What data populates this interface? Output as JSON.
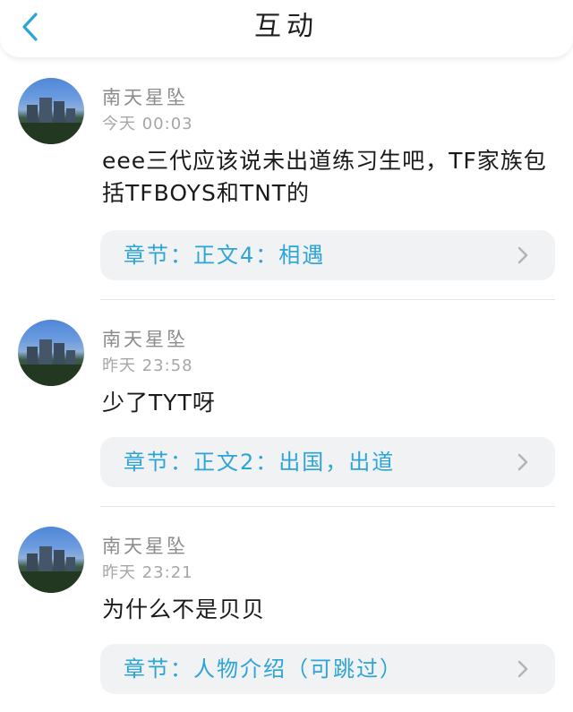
{
  "header": {
    "title": "互动",
    "back_icon": "chevron-left-icon",
    "accent": "#2ca4d6"
  },
  "comments": [
    {
      "username": "南天星坠",
      "time": "今天 00:03",
      "text": "eee三代应该说未出道练习生吧，TF家族包括TFBOYS和TNT的",
      "chapter": "章节：正文4：相遇"
    },
    {
      "username": "南天星坠",
      "time": "昨天 23:58",
      "text": "少了TYT呀",
      "chapter": "章节：正文2：出国，出道"
    },
    {
      "username": "南天星坠",
      "time": "昨天 23:21",
      "text": "为什么不是贝贝",
      "chapter": "章节：人物介绍（可跳过）"
    }
  ]
}
